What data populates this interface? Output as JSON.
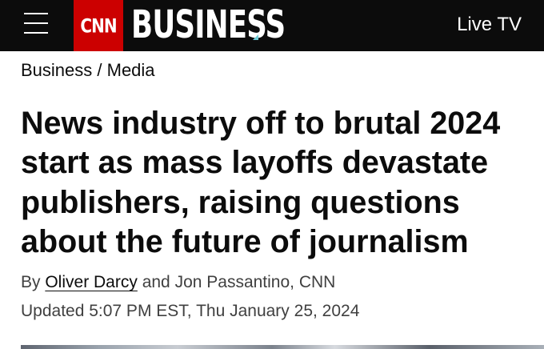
{
  "header": {
    "menu_icon": "hamburger-menu-icon",
    "logo_text": "CNN",
    "section_name": "BUSINESS",
    "live_tv_label": "Live TV",
    "brand_color": "#cc0000",
    "accent_color": "#6ecbd6"
  },
  "breadcrumb": {
    "section": "Business",
    "separator": " / ",
    "subsection": "Media"
  },
  "article": {
    "headline": "News industry off to brutal 2024 start as mass layoffs devastate publishers, raising questions about the future of journalism",
    "byline": {
      "prefix": "By ",
      "author_1": "Oliver Darcy",
      "rest": " and Jon Passantino, CNN"
    },
    "timestamp": "Updated 5:07 PM EST, Thu January 25, 2024"
  }
}
